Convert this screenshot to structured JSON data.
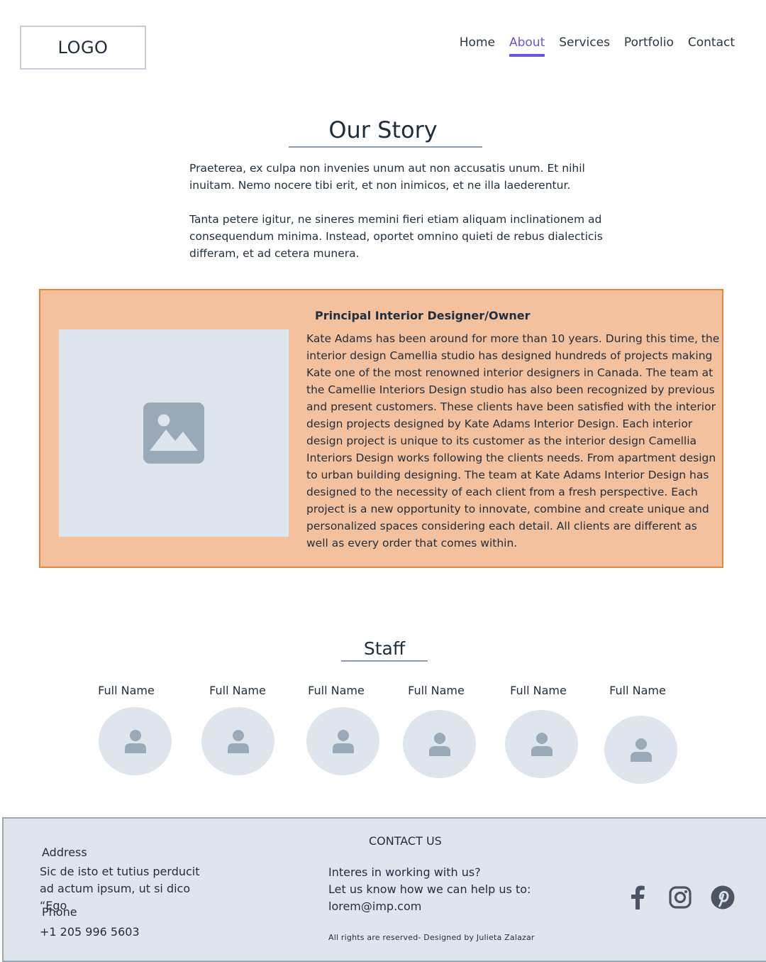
{
  "header": {
    "logo": "LOGO",
    "nav": [
      {
        "label": "Home",
        "active": false
      },
      {
        "label": "About",
        "active": true
      },
      {
        "label": "Services",
        "active": false
      },
      {
        "label": "Portfolio",
        "active": false
      },
      {
        "label": "Contact",
        "active": false
      }
    ]
  },
  "story": {
    "title": "Our Story",
    "paragraphs": [
      "Praeterea, ex culpa non invenies unum aut non accusatis unum. Et nihil inuitam. Nemo nocere tibi erit, et non inimicos, et ne illa laederentur.",
      "Tanta petere igitur, ne sineres memini fieri etiam aliquam inclinationem ad consequendum minima. Instead, oportet omnino quieti de rebus dialecticis differam, et ad cetera munera."
    ]
  },
  "principal": {
    "heading": "Principal Interior Designer/Owner",
    "image_icon": "image-placeholder-icon",
    "bio": "Kate Adams has been around for more than 10 years. During this time, the interior design Camellia studio has designed hundreds of projects making Kate one of the most renowned interior designers in Canada. The team at the Camellie Interiors Design studio has also been recognized by previous and present customers. These clients have been satisfied with the interior design projects designed by Kate Adams Interior Design. Each interior design project is unique to its customer as the interior design Camellia Interiors Design works following the clients needs. From apartment design to urban building designing. The team at Kate Adams Interior Design has designed to the necessity of each client from a fresh perspective. Each project is a new opportunity to innovate, combine and create unique and personalized spaces considering each detail. All clients are different as well as every order that comes within."
  },
  "staff": {
    "title": "Staff",
    "members": [
      {
        "name": "Full Name",
        "icon": "user-icon"
      },
      {
        "name": "Full Name",
        "icon": "user-icon"
      },
      {
        "name": "Full Name",
        "icon": "user-icon"
      },
      {
        "name": "Full Name",
        "icon": "user-icon"
      },
      {
        "name": "Full Name",
        "icon": "user-icon"
      },
      {
        "name": "Full Name",
        "icon": "user-icon"
      }
    ]
  },
  "footer": {
    "address_label": "Address",
    "address_text": "Sic de isto et tutius perducit ad actum ipsum, ut si dico “Ego",
    "phone_label": "Phone",
    "phone_value": "+1 205 996 5603",
    "contact_title": "CONTACT US",
    "contact_line1": "Interes in working with us?",
    "contact_line2": "Let us know how we can help us to:",
    "contact_email": "lorem@imp.com",
    "copyright": "All rights are reserved- Designed by Julieta Zalazar",
    "social": [
      "facebook-icon",
      "instagram-icon",
      "pinterest-icon"
    ]
  },
  "colors": {
    "accent": "#6a52d9",
    "panel_bg": "#f3c19e",
    "panel_border": "#e8853e",
    "placeholder_bg": "#dfe5ed",
    "icon_gray": "#9aa9b7",
    "text": "#1f2d3d"
  }
}
